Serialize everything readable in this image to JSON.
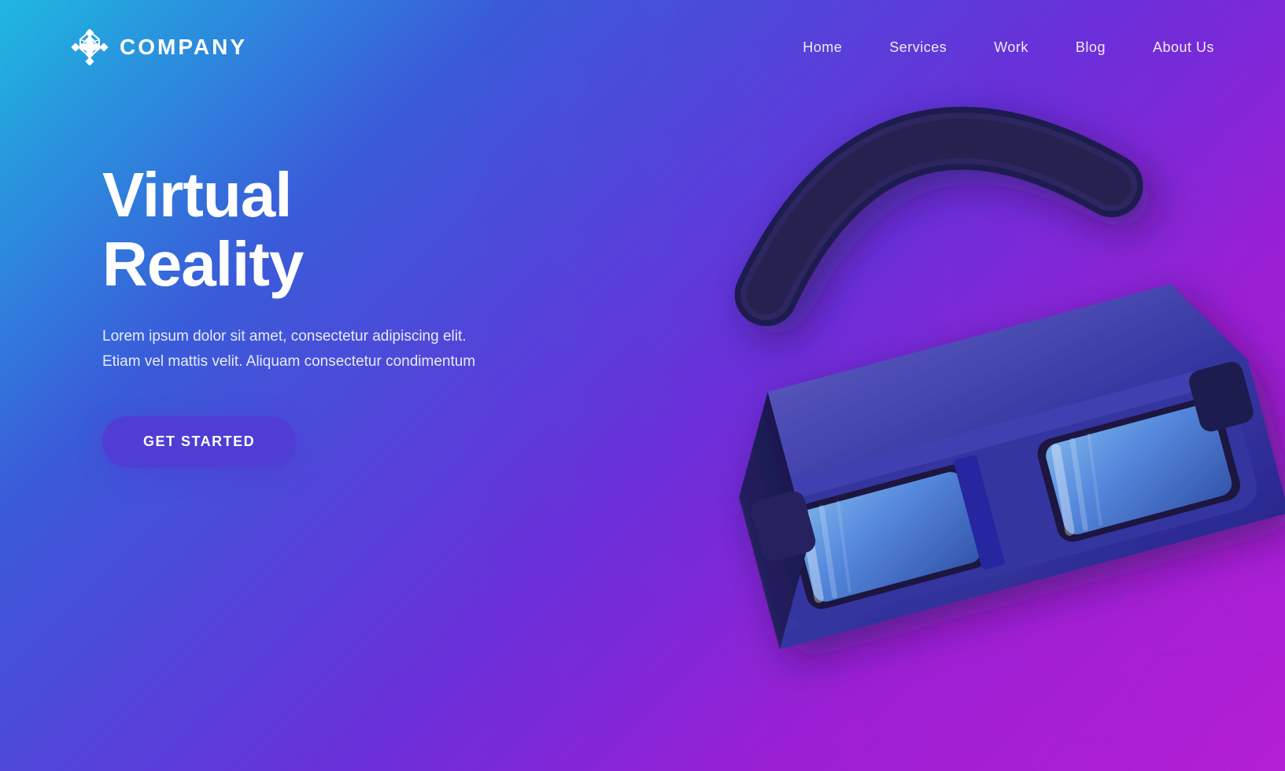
{
  "logo": {
    "text": "COMPANY"
  },
  "nav": {
    "links": [
      {
        "label": "Home",
        "id": "home"
      },
      {
        "label": "Services",
        "id": "services"
      },
      {
        "label": "Work",
        "id": "work"
      },
      {
        "label": "Blog",
        "id": "blog"
      },
      {
        "label": "About Us",
        "id": "about"
      }
    ]
  },
  "hero": {
    "title": "Virtual Reality",
    "description": "Lorem ipsum dolor sit amet, consectetur adipiscing elit. Etiam vel mattis velit. Aliquam consectetur condimentum",
    "cta_label": "Get Started"
  },
  "colors": {
    "bg_start": "#1eb8e0",
    "bg_end": "#b41fd4",
    "accent": "#4f3dd4"
  }
}
